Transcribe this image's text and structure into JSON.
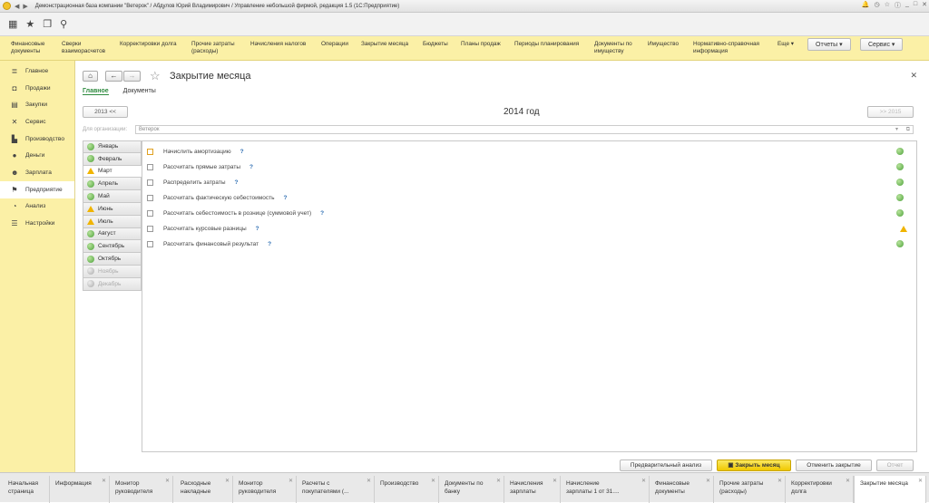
{
  "window_title": "Демонстрационная база компании \"Ветерок\" / Абдулов Юрий Владимирович / Управление небольшой фирмой, редакция 1.5  (1С:Предприятие)",
  "sections": [
    {
      "label": "Финансовые\nдокументы"
    },
    {
      "label": "Сверки\nвзаиморасчетов"
    },
    {
      "label": "Корректировки долга"
    },
    {
      "label": "Прочие затраты\n(расходы)"
    },
    {
      "label": "Начисления налогов"
    },
    {
      "label": "Операции"
    },
    {
      "label": "Закрытие месяца"
    },
    {
      "label": "Бюджеты"
    },
    {
      "label": "Планы продаж"
    },
    {
      "label": "Периоды планирования"
    },
    {
      "label": "Документы по\nимуществу"
    },
    {
      "label": "Имущество"
    },
    {
      "label": "Нормативно-справочная\nинформация"
    },
    {
      "label": "Еще ▾"
    }
  ],
  "reports_label": "Отчеты  ▾",
  "service_label": "Сервис  ▾",
  "sidebar": [
    {
      "label": "Главное",
      "icon": "menu-icon"
    },
    {
      "label": "Продажи",
      "icon": "bag-icon"
    },
    {
      "label": "Закупки",
      "icon": "cart-icon"
    },
    {
      "label": "Сервис",
      "icon": "tools-icon"
    },
    {
      "label": "Производство",
      "icon": "factory-icon"
    },
    {
      "label": "Деньги",
      "icon": "money-icon"
    },
    {
      "label": "Зарплата",
      "icon": "people-icon"
    },
    {
      "label": "Предприятие",
      "icon": "flag-icon"
    },
    {
      "label": "Анализ",
      "icon": "chart-icon"
    },
    {
      "label": "Настройки",
      "icon": "gear-icon"
    }
  ],
  "page_title": "Закрытие месяца",
  "tabs": {
    "main": "Главное",
    "docs": "Документы"
  },
  "prev_year_label": "2013 <<",
  "year_label": "2014  год",
  "next_year_label": ">> 2015",
  "org_label": "Для организации:",
  "org_value": "Ветерок",
  "months": [
    {
      "label": "Январь",
      "status": "ok"
    },
    {
      "label": "Февраль",
      "status": "ok"
    },
    {
      "label": "Март",
      "status": "warn"
    },
    {
      "label": "Апрель",
      "status": "ok"
    },
    {
      "label": "Май",
      "status": "ok"
    },
    {
      "label": "Июнь",
      "status": "warn"
    },
    {
      "label": "Июль",
      "status": "warn"
    },
    {
      "label": "Август",
      "status": "ok"
    },
    {
      "label": "Сентябрь",
      "status": "ok"
    },
    {
      "label": "Октябрь",
      "status": "ok"
    },
    {
      "label": "Ноябрь",
      "status": "none"
    },
    {
      "label": "Декабрь",
      "status": "none"
    }
  ],
  "operations": [
    {
      "label": "Начислить амортизацию",
      "help": "?",
      "status": "ok"
    },
    {
      "label": "Рассчитать прямые затраты",
      "help": "?",
      "status": "ok"
    },
    {
      "label": "Распределить затраты",
      "help": "?",
      "status": "ok"
    },
    {
      "label": "Рассчитать фактическую себестоимость",
      "help": "?",
      "status": "ok"
    },
    {
      "label": "Рассчитать себестоимость в рознице (суммовой учет)",
      "help": "?",
      "status": "ok"
    },
    {
      "label": "Рассчитать курсовые разницы",
      "help": "?",
      "status": "warn"
    },
    {
      "label": "Рассчитать финансовый результат",
      "help": "?",
      "status": "ok"
    }
  ],
  "buttons": {
    "preliminary": "Предварительный анализ",
    "close_month": "Закрыть месяц",
    "cancel_close": "Отменить закрытие",
    "report": "Отчет"
  },
  "bottom_tabs": [
    {
      "label": "Начальная\nстраница"
    },
    {
      "label": "Информация"
    },
    {
      "label": "Монитор\nруководителя"
    },
    {
      "label": "Расходные\nнакладные"
    },
    {
      "label": "Монитор\nруководителя"
    },
    {
      "label": "Расчеты с\nпокупателями (..."
    },
    {
      "label": "Производство"
    },
    {
      "label": "Документы по\nбанку"
    },
    {
      "label": "Начисления\nзарплаты"
    },
    {
      "label": "Начисление\nзарплаты 1 от 31...."
    },
    {
      "label": "Финансовые\nдокументы"
    },
    {
      "label": "Прочие затраты\n(расходы)"
    },
    {
      "label": "Корректировки\nдолга"
    },
    {
      "label": "Закрытие месяца"
    }
  ]
}
